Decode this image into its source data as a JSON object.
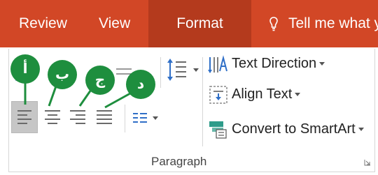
{
  "tabs": {
    "review": "Review",
    "view": "View",
    "format": "Format",
    "tell_me": "Tell me what y"
  },
  "paragraph": {
    "text_direction": "Text Direction",
    "align_text": "Align Text",
    "convert_smartart": "Convert to SmartArt",
    "group_label": "Paragraph"
  },
  "callouts": {
    "a": "أ",
    "b": "ب",
    "c": "ج",
    "d": "د"
  },
  "colors": {
    "tab_bar": "#d24726",
    "active_tab": "#b43a1d",
    "callout_green": "#1e8e3e",
    "selected_button": "#c6c6c6"
  },
  "icons": [
    "lightbulb-icon",
    "align-left-icon",
    "center-icon",
    "align-right-icon",
    "justify-icon",
    "columns-icon",
    "line-spacing-icon",
    "text-direction-icon",
    "align-text-icon",
    "smartart-icon",
    "dialog-launcher-icon"
  ]
}
